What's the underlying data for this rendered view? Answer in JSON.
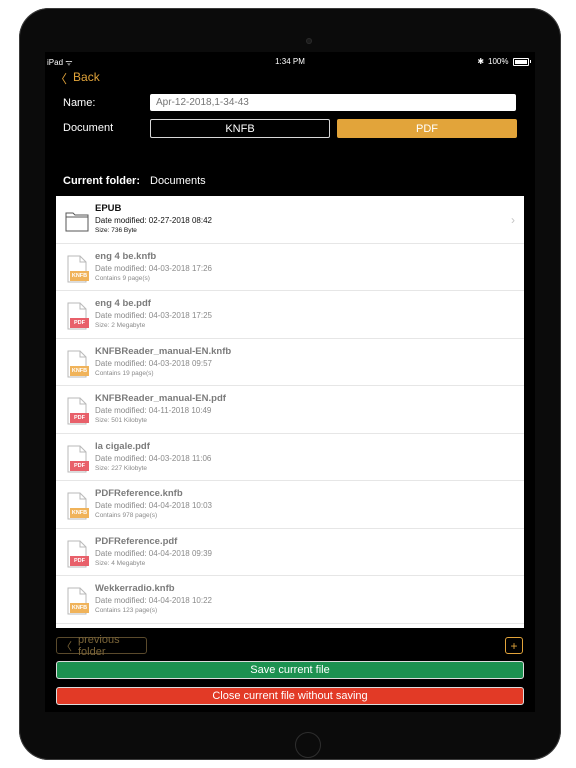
{
  "status_bar": {
    "device": "iPad",
    "time": "1:34 PM",
    "battery": "100%"
  },
  "nav": {
    "back_label": "Back"
  },
  "form": {
    "name_label": "Name:",
    "name_placeholder": "Apr-12-2018,1-34-43",
    "document_label": "Document",
    "options": [
      "KNFB",
      "PDF"
    ],
    "selected": "PDF"
  },
  "folder": {
    "label": "Current folder:",
    "name": "Documents"
  },
  "files": [
    {
      "kind": "folder",
      "name": "EPUB",
      "date": "Date modified: 02-27-2018 08:42",
      "size": "Size: 736 Byte"
    },
    {
      "kind": "knfb",
      "name": "eng 4 be.knfb",
      "date": "Date modified: 04-03-2018 17:26",
      "size": "Contains 9 page(s)"
    },
    {
      "kind": "pdf",
      "name": "eng 4 be.pdf",
      "date": "Date modified: 04-03-2018 17:25",
      "size": "Size: 2 Megabyte"
    },
    {
      "kind": "knfb",
      "name": "KNFBReader_manual-EN.knfb",
      "date": "Date modified: 04-03-2018 09:57",
      "size": "Contains 19 page(s)"
    },
    {
      "kind": "pdf",
      "name": "KNFBReader_manual-EN.pdf",
      "date": "Date modified: 04-11-2018 10:49",
      "size": "Size: 501 Kilobyte"
    },
    {
      "kind": "pdf",
      "name": "la cigale.pdf",
      "date": "Date modified: 04-03-2018 11:06",
      "size": "Size: 227 Kilobyte"
    },
    {
      "kind": "knfb",
      "name": "PDFReference.knfb",
      "date": "Date modified: 04-04-2018 10:03",
      "size": "Contains 978 page(s)"
    },
    {
      "kind": "pdf",
      "name": "PDFReference.pdf",
      "date": "Date modified: 04-04-2018 09:39",
      "size": "Size: 4 Megabyte"
    },
    {
      "kind": "knfb",
      "name": "Wekkerradio.knfb",
      "date": "Date modified: 04-04-2018 10:22",
      "size": "Contains 123 page(s)"
    }
  ],
  "icon_badges": {
    "knfb": "KNFB",
    "pdf": "PDF"
  },
  "footer": {
    "previous_folder": "previous folder",
    "add": "+",
    "save": "Save current file",
    "close": "Close current file without saving"
  },
  "colors": {
    "accent": "#e2a43a",
    "save": "#1c9150",
    "close": "#e23a26",
    "knfb_badge": "#f0b35a",
    "pdf_badge": "#e8606a"
  }
}
